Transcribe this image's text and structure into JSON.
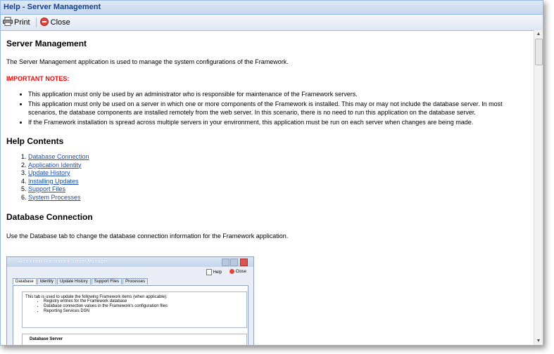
{
  "window": {
    "title": "Help - Server Management"
  },
  "toolbar": {
    "print_label": "Print",
    "close_label": "Close"
  },
  "main": {
    "heading": "Server Management",
    "intro": "The Server Management application is used to manage the system configurations of the Framework.",
    "important_label": "IMPORTANT NOTES:",
    "notes": [
      "This application must only be used by an administrator who is responsible for maintenance of the Framework servers.",
      "This application must only be used on a server in which one or more components of the Framework is installed. This may or may not include the database server. In most scenarios, the database components are installed remotely from the web server. In this scenario, there is no need to run this application on the database server.",
      "If the Framework installation is spread across multiple servers in your environment, this application must be run on each server when changes are being made."
    ],
    "contents_heading": "Help Contents",
    "contents": [
      "Database Connection",
      "Application Identity",
      "Update History",
      "Installing Updates",
      "Support Files",
      "System Processes"
    ],
    "section_heading": "Database Connection",
    "section_text": "Use the Database tab to change the database connection information for the Framework application."
  },
  "screenshot": {
    "title": "Akcelerant Framework Server Manager",
    "help_label": "Help",
    "close_label": "Close",
    "tabs": [
      "Database",
      "Identity",
      "Update History",
      "Support Files",
      "Processes"
    ],
    "intro": "This tab is used to update the following Framework items (when applicable):",
    "items": [
      "Registry entries for the Framework database",
      "Database connection values in the Framework's configuration files",
      "Reporting Services DSN"
    ],
    "box2_label": "Database Server"
  }
}
